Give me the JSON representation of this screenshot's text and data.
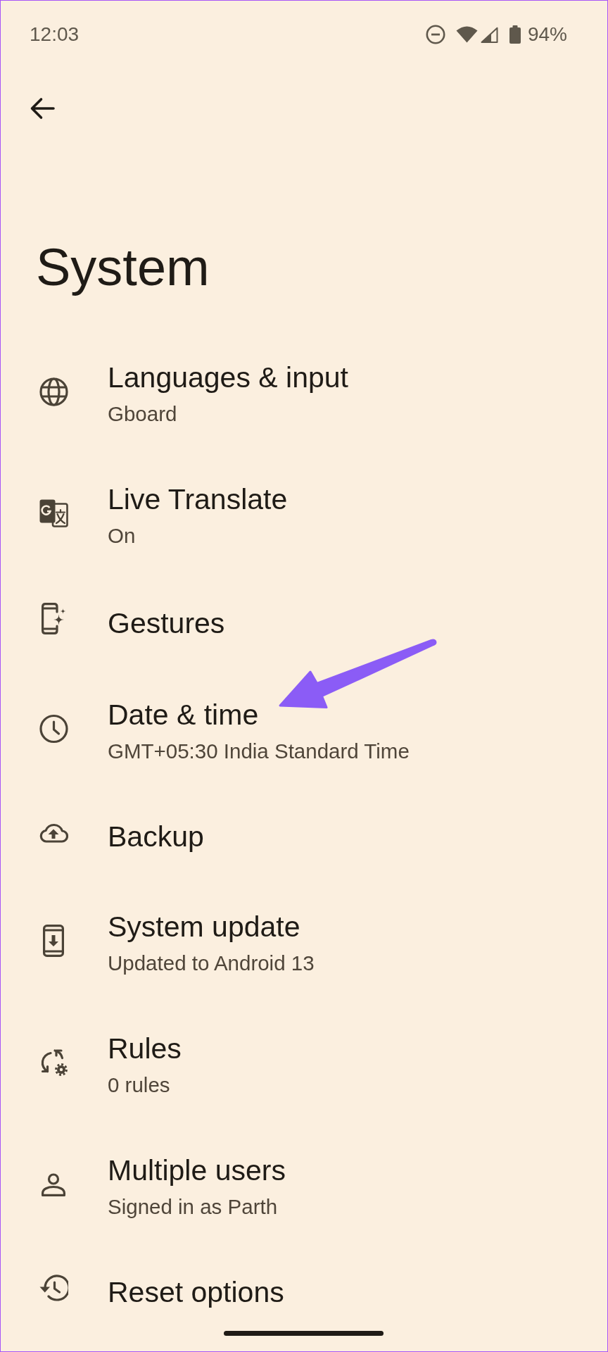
{
  "status_bar": {
    "time": "12:03",
    "battery": "94%"
  },
  "title": "System",
  "items": [
    {
      "title": "Languages & input",
      "subtitle": "Gboard",
      "arrow": false
    },
    {
      "title": "Live Translate",
      "subtitle": "On",
      "arrow": false
    },
    {
      "title": "Gestures",
      "arrow": false
    },
    {
      "title": "Date & time",
      "subtitle": "GMT+05:30 India Standard Time",
      "arrow": true
    },
    {
      "title": "Backup",
      "arrow": false
    },
    {
      "title": "System update",
      "subtitle": "Updated to Android 13",
      "arrow": false
    },
    {
      "title": "Rules",
      "subtitle": "0 rules",
      "arrow": false
    },
    {
      "title": "Multiple users",
      "subtitle": "Signed in as Parth",
      "arrow": false
    },
    {
      "title": "Reset options",
      "arrow": false
    }
  ]
}
